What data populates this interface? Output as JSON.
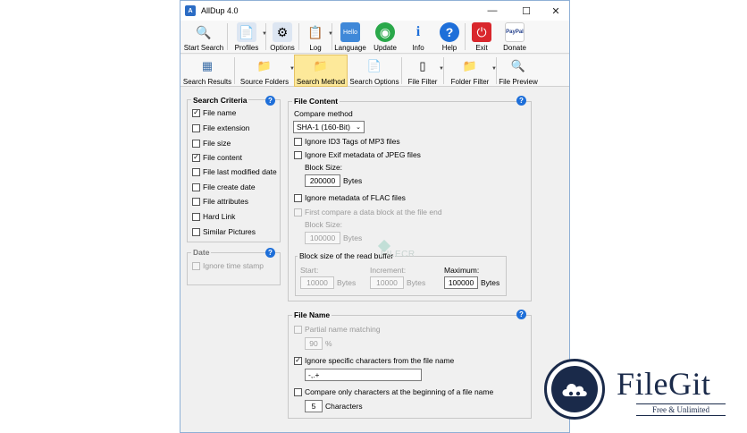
{
  "window": {
    "title": "AllDup 4.0",
    "minimize": "—",
    "maximize": "☐",
    "close": "✕"
  },
  "toolbar": [
    {
      "label": "Start Search",
      "icon": "magnifier-icon",
      "glyph": "🔍"
    },
    {
      "label": "Profiles",
      "icon": "profiles-icon",
      "glyph": "📄",
      "dropdown": true
    },
    {
      "label": "Options",
      "icon": "options-icon",
      "glyph": "⚙"
    },
    {
      "label": "Log",
      "icon": "log-icon",
      "glyph": "📋",
      "dropdown": true
    },
    {
      "label": "Language",
      "icon": "language-icon",
      "glyph": "Hello"
    },
    {
      "label": "Update",
      "icon": "update-icon",
      "glyph": "◉"
    },
    {
      "label": "Info",
      "icon": "info-icon",
      "glyph": "i"
    },
    {
      "label": "Help",
      "icon": "help-icon",
      "glyph": "?"
    },
    {
      "label": "Exit",
      "icon": "exit-icon",
      "glyph": "⏻"
    },
    {
      "label": "Donate",
      "icon": "paypal-icon",
      "glyph": "PayPal"
    }
  ],
  "toolbar2": [
    {
      "label": "Search Results",
      "icon": "search-results-icon",
      "glyph": "▦"
    },
    {
      "label": "Source Folders",
      "icon": "source-folders-icon",
      "glyph": "📁",
      "dropdown": true
    },
    {
      "label": "Search Method",
      "icon": "search-method-icon",
      "glyph": "📁",
      "active": true
    },
    {
      "label": "Search Options",
      "icon": "search-options-icon",
      "glyph": "📄"
    },
    {
      "label": "File Filter",
      "icon": "file-filter-icon",
      "glyph": "▯",
      "dropdown": true
    },
    {
      "label": "Folder Filter",
      "icon": "folder-filter-icon",
      "glyph": "📁",
      "dropdown": true
    },
    {
      "label": "File Preview",
      "icon": "file-preview-icon",
      "glyph": "🔍"
    }
  ],
  "search_criteria": {
    "title": "Search Criteria",
    "items": [
      {
        "label": "File name",
        "checked": true
      },
      {
        "label": "File extension",
        "checked": false
      },
      {
        "label": "File size",
        "checked": false
      },
      {
        "label": "File content",
        "checked": true
      },
      {
        "label": "File last modified date",
        "checked": false
      },
      {
        "label": "File create date",
        "checked": false
      },
      {
        "label": "File attributes",
        "checked": false
      },
      {
        "label": "Hard Link",
        "checked": false
      },
      {
        "label": "Similar Pictures",
        "checked": false
      }
    ]
  },
  "date": {
    "title": "Date",
    "ignore_time_stamp": "Ignore time stamp"
  },
  "file_content": {
    "title": "File Content",
    "compare_method_label": "Compare method",
    "compare_method_value": "SHA-1 (160-Bit)",
    "ignore_id3": "Ignore ID3 Tags of MP3 files",
    "ignore_exif": "Ignore Exif metadata of JPEG files",
    "block_size_label": "Block Size:",
    "exif_block_size": "200000",
    "bytes": "Bytes",
    "ignore_flac": "Ignore metadata of FLAC files",
    "first_compare": "First compare a data block at the file end",
    "end_block_size_label": "Block Size:",
    "end_block_size": "100000",
    "read_buffer_title": "Block size of the read buffer",
    "start_label": "Start:",
    "start_value": "10000",
    "increment_label": "Increment:",
    "increment_value": "10000",
    "maximum_label": "Maximum:",
    "maximum_value": "100000"
  },
  "file_name": {
    "title": "File Name",
    "partial_matching": "Partial name matching",
    "partial_value": "90",
    "percent": "%",
    "ignore_chars": "Ignore specific characters from the file name",
    "ignore_chars_value": "-,.+",
    "compare_only": "Compare only characters at the beginning of a file name",
    "characters_value": "5",
    "characters_label": "Characters"
  },
  "watermark": {
    "text": "FILECR"
  },
  "brand": {
    "name": "FileGit",
    "tagline": "Free & Unlimited"
  },
  "colors": {
    "accent": "#1e6fd9",
    "active_tab": "#fde99a",
    "brand": "#1a2a4a"
  }
}
